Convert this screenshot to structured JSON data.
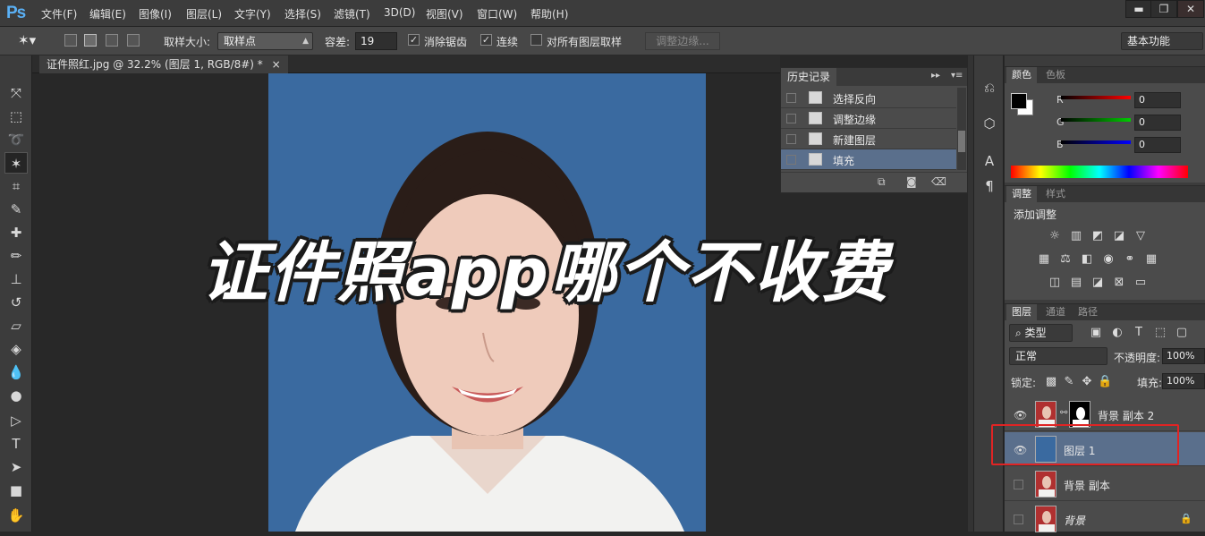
{
  "app": {
    "logo": "Ps"
  },
  "menu": [
    "文件(F)",
    "编辑(E)",
    "图像(I)",
    "图层(L)",
    "文字(Y)",
    "选择(S)",
    "滤镜(T)",
    "3D(D)",
    "视图(V)",
    "窗口(W)",
    "帮助(H)"
  ],
  "window_controls": {
    "minimize": "▬",
    "restore": "❐",
    "close": "✕"
  },
  "options": {
    "sample_size_label": "取样大小:",
    "sample_size_value": "取样点",
    "tolerance_label": "容差:",
    "tolerance_value": "19",
    "antialias_label": "消除锯齿",
    "antialias_checked": true,
    "contiguous_label": "连续",
    "contiguous_checked": true,
    "all_layers_label": "对所有图层取样",
    "all_layers_checked": false,
    "refine_edge_label": "调整边缘...",
    "workspace": "基本功能"
  },
  "document": {
    "tab_title": "证件照红.jpg @ 32.2% (图层 1, RGB/8#) *",
    "tab_close": "×"
  },
  "overlay_title": "证件照app哪个不收费",
  "history": {
    "tab": "历史记录",
    "items": [
      {
        "label": "选择反向",
        "active": false
      },
      {
        "label": "调整边缘",
        "active": false
      },
      {
        "label": "新建图层",
        "active": false
      },
      {
        "label": "填充",
        "active": true
      }
    ]
  },
  "color_panel": {
    "tabs": [
      "颜色",
      "色板"
    ],
    "channels": [
      {
        "label": "R",
        "value": "0",
        "color": "#ff0000"
      },
      {
        "label": "G",
        "value": "0",
        "color": "#00cc00"
      },
      {
        "label": "B",
        "value": "0",
        "color": "#0000ff"
      }
    ]
  },
  "adjust_panel": {
    "tabs": [
      "调整",
      "样式"
    ],
    "add_label": "添加调整"
  },
  "layers_panel": {
    "tabs": [
      "图层",
      "通道",
      "路径"
    ],
    "filter_label": "类型",
    "blend_mode": "正常",
    "opacity_label": "不透明度:",
    "opacity_value": "100%",
    "lock_label": "锁定:",
    "fill_label": "填充:",
    "fill_value": "100%",
    "layers": [
      {
        "name": "背景 副本 2",
        "visible": true,
        "active": false,
        "has_mask": true
      },
      {
        "name": "图层 1",
        "visible": true,
        "active": true,
        "has_mask": false,
        "fill_color": "#3a6aa0"
      },
      {
        "name": "背景 副本",
        "visible": false,
        "active": false,
        "has_mask": false
      },
      {
        "name": "背景",
        "visible": false,
        "active": false,
        "has_mask": false,
        "locked": true
      }
    ]
  },
  "colors": {
    "photo_bg": "#3a6aa0",
    "highlight": "#e02424",
    "selected_row": "#5a6f8c"
  }
}
